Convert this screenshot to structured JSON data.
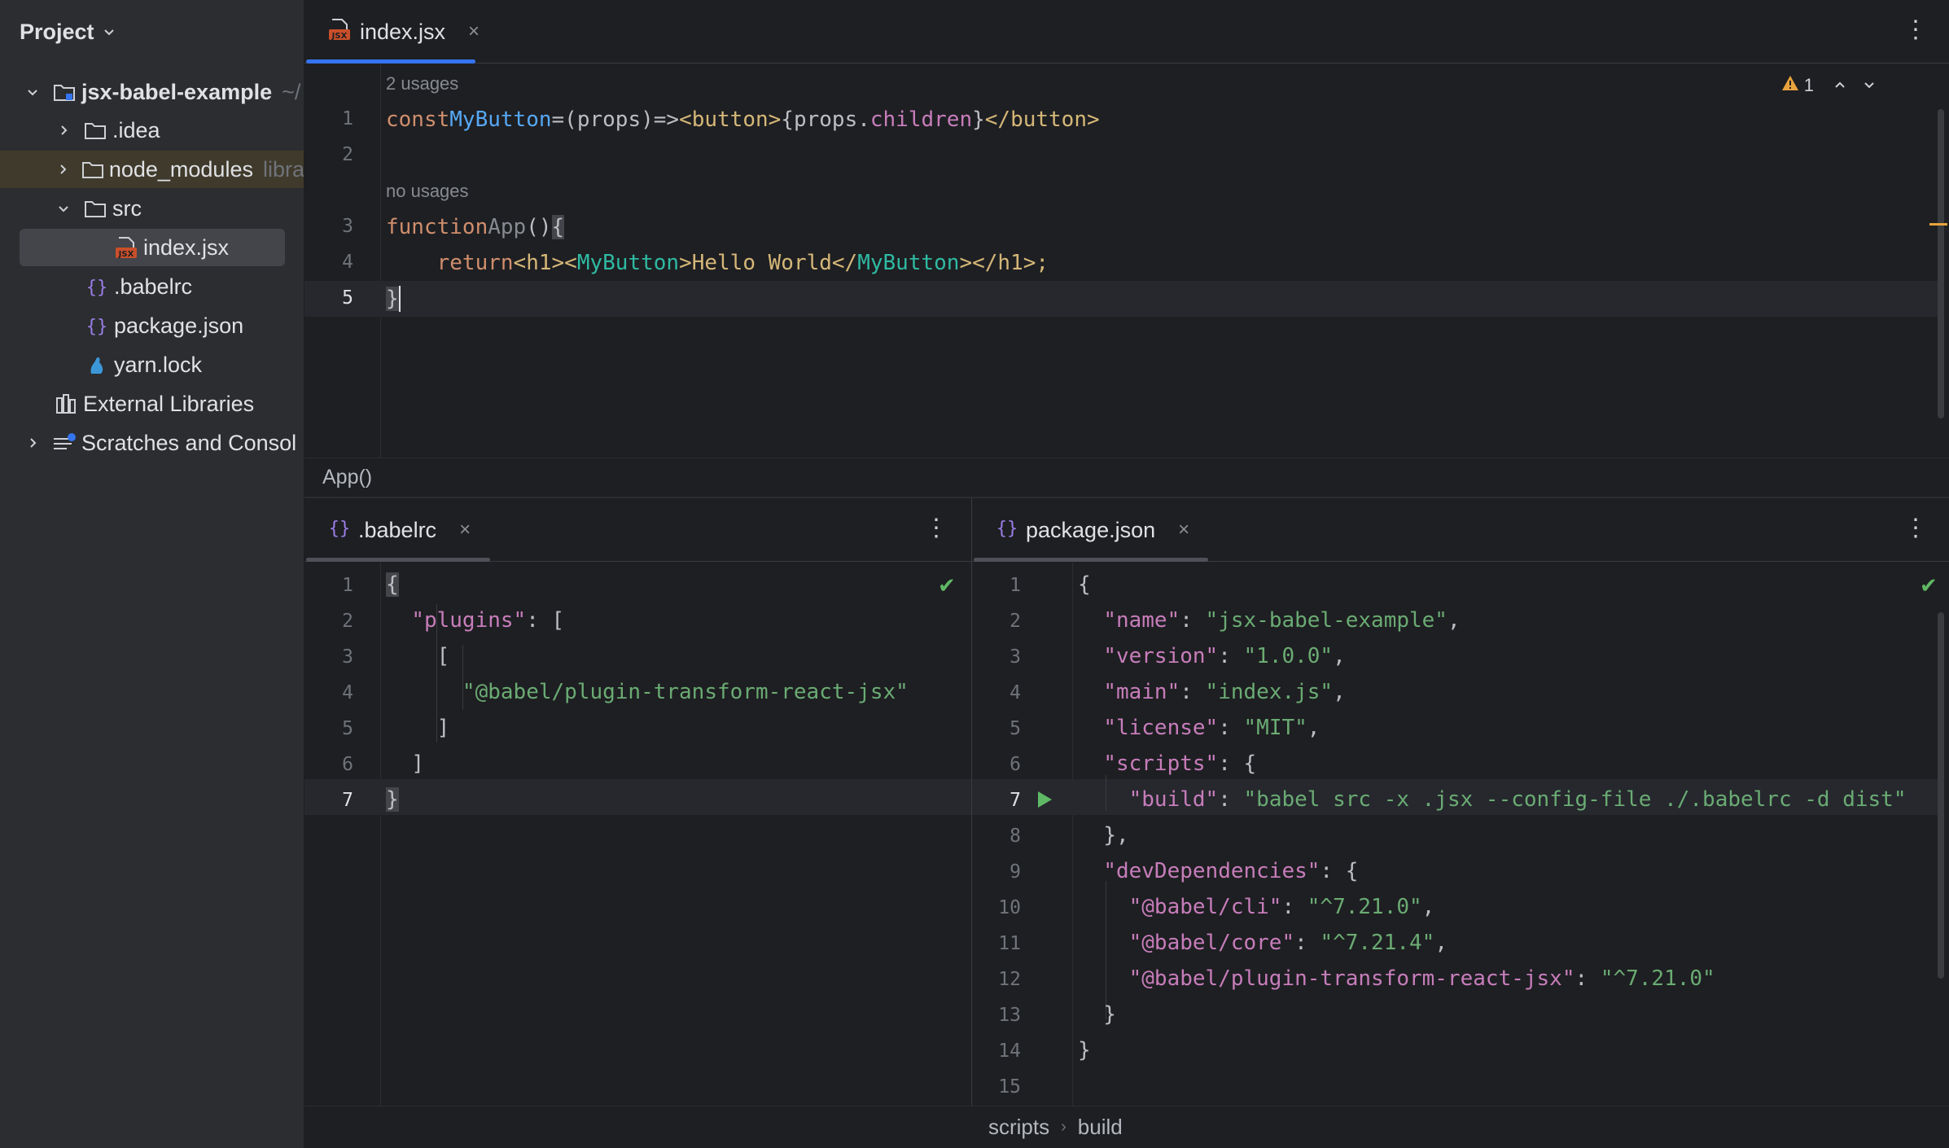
{
  "sidebar": {
    "title": "Project",
    "tree": [
      {
        "label": "jsx-babel-example",
        "hint": "~/",
        "expanded": true,
        "bold": true,
        "icon": "project-folder-icon"
      },
      {
        "label": ".idea",
        "hint": "",
        "icon": "folder-icon"
      },
      {
        "label": "node_modules",
        "hint": "libra",
        "icon": "folder-icon"
      },
      {
        "label": "src",
        "hint": "",
        "icon": "folder-icon",
        "expanded": true
      },
      {
        "label": "index.jsx",
        "hint": "",
        "icon": "jsx-file-icon",
        "selected": true
      },
      {
        "label": ".babelrc",
        "hint": "",
        "icon": "json-file-icon"
      },
      {
        "label": "package.json",
        "hint": "",
        "icon": "json-file-icon"
      },
      {
        "label": "yarn.lock",
        "hint": "",
        "icon": "yarn-icon"
      },
      {
        "label": "External Libraries",
        "hint": "",
        "icon": "libraries-icon"
      },
      {
        "label": "Scratches and Consol",
        "hint": "",
        "icon": "scratches-icon"
      }
    ],
    "jsx_badge": "JSX"
  },
  "editor_top": {
    "tab": {
      "label": "index.jsx",
      "close": "×"
    },
    "warning_count": "1",
    "inlay_hints": [
      "2 usages",
      "no usages"
    ],
    "line_numbers": [
      "1",
      "2",
      "3",
      "4",
      "5"
    ],
    "lines": {
      "l1": [
        "const",
        "MyButton",
        "=",
        "(props)",
        "=>",
        "<button>",
        "{props.",
        "children",
        "}",
        "</button>"
      ],
      "l3": [
        "function",
        "App",
        "()",
        "{"
      ],
      "l4": [
        "return",
        "<h1><",
        "MyButton",
        ">Hello World</",
        "MyButton",
        "></h1>;"
      ],
      "l5": [
        "}"
      ]
    },
    "breadcrumb": "App()"
  },
  "editor_babelrc": {
    "tab": {
      "label": ".babelrc",
      "close": "×"
    },
    "line_numbers": [
      "1",
      "2",
      "3",
      "4",
      "5",
      "6",
      "7"
    ],
    "lines": [
      "{",
      "\"plugins\"",
      ": [",
      "[",
      "\"@babel/plugin-transform-react-jsx\"",
      "]",
      "]",
      "}"
    ]
  },
  "editor_package": {
    "tab": {
      "label": "package.json",
      "close": "×"
    },
    "line_numbers": [
      "1",
      "2",
      "3",
      "4",
      "5",
      "6",
      "7",
      "8",
      "9",
      "10",
      "11",
      "12",
      "13",
      "14",
      "15"
    ],
    "entries": [
      {
        "key": "\"name\"",
        "value": "\"jsx-babel-example\"",
        "tail": ","
      },
      {
        "key": "\"version\"",
        "value": "\"1.0.0\"",
        "tail": ","
      },
      {
        "key": "\"main\"",
        "value": "\"index.js\"",
        "tail": ","
      },
      {
        "key": "\"license\"",
        "value": "\"MIT\"",
        "tail": ","
      },
      {
        "key": "\"scripts\"",
        "value": "",
        "tail": "{"
      },
      {
        "key": "\"build\"",
        "value": "\"babel src -x .jsx --config-file ./.babelrc -d dist\"",
        "tail": ""
      },
      {
        "key": "",
        "value": "",
        "tail": "},"
      },
      {
        "key": "\"devDependencies\"",
        "value": "",
        "tail": "{"
      },
      {
        "key": "\"@babel/cli\"",
        "value": "\"^7.21.0\"",
        "tail": ","
      },
      {
        "key": "\"@babel/core\"",
        "value": "\"^7.21.4\"",
        "tail": ","
      },
      {
        "key": "\"@babel/plugin-transform-react-jsx\"",
        "value": "\"^7.21.0\"",
        "tail": ""
      }
    ],
    "breadcrumb": [
      "scripts",
      "build"
    ]
  },
  "colors": {
    "accent": "#3574f0",
    "warning": "#e8a33d",
    "ok": "#5fb865"
  }
}
